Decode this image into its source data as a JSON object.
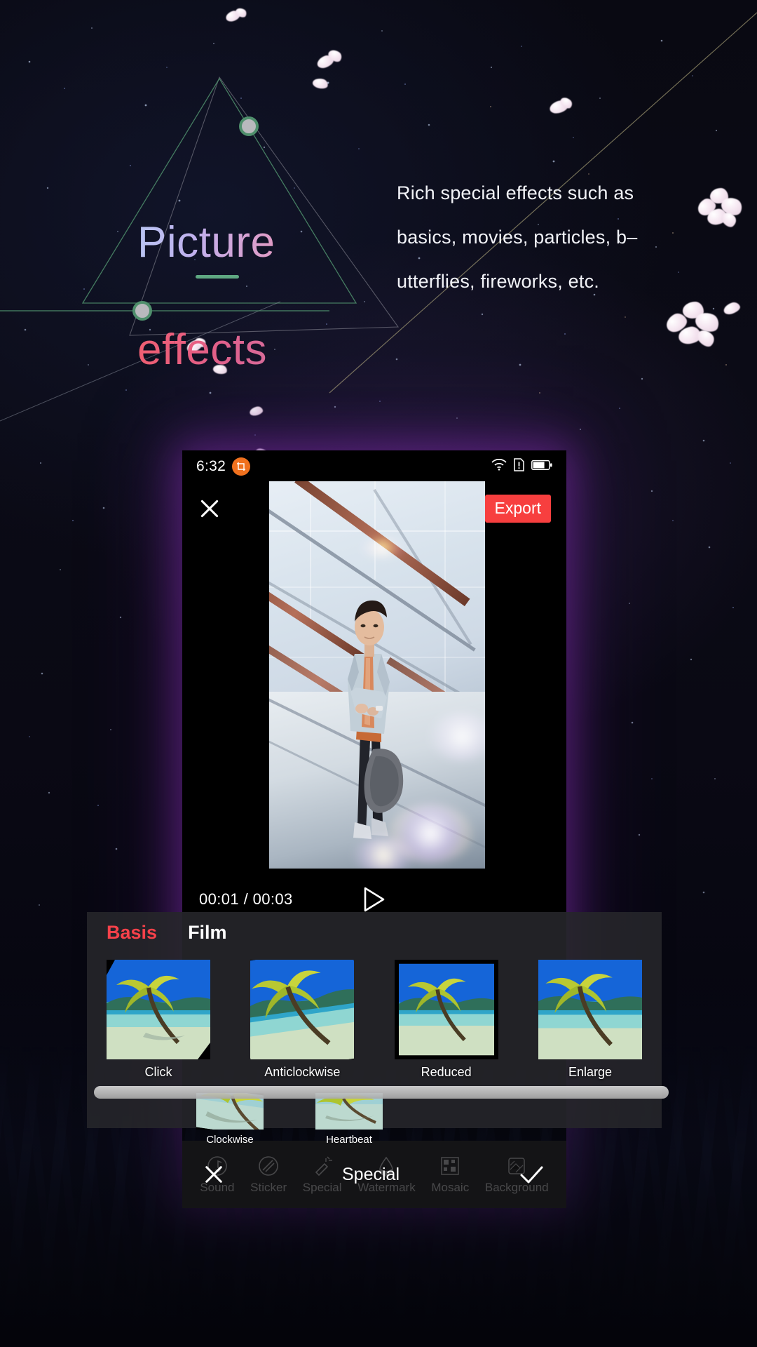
{
  "hero": {
    "title_line1": "Picture",
    "title_line2": "effects",
    "description": "Rich special effects such as basics, movies, particles, b–utterflies, fireworks, etc.",
    "accent_green": "#5fa882",
    "title_gradient_top": "#b9c4f2",
    "title_gradient_bottom": "#ef5f72"
  },
  "phone": {
    "statusbar": {
      "time": "6:32",
      "badge_icon": "crop-icon",
      "wifi_icon": "wifi-icon",
      "sim_icon": "sim-alert-icon",
      "battery_icon": "battery-icon"
    },
    "topbar": {
      "close_icon": "close-icon",
      "export_label": "Export",
      "export_color": "#f73f3f"
    },
    "preview": {
      "alt": "young man in denim jacket standing on stairs inside glass building"
    },
    "timeline": {
      "current_time": "00:01",
      "separator": "/",
      "total_time": "00:03",
      "time_display": "00:01 / 00:03",
      "play_icon": "play-icon"
    },
    "effects_panel": {
      "tabs": [
        {
          "label": "Basis",
          "active": true
        },
        {
          "label": "Film",
          "active": false
        }
      ],
      "active_tab_color": "#f7414a",
      "items_row1": [
        {
          "label": "Click"
        },
        {
          "label": "Anticlockwise"
        },
        {
          "label": "Reduced"
        },
        {
          "label": "Enlarge"
        }
      ],
      "items_row2": [
        {
          "label": "Clockwise"
        },
        {
          "label": "Heartbeat"
        }
      ]
    },
    "toolbar": {
      "ghost_items": [
        {
          "label": "Sound",
          "icon": "music-note-icon"
        },
        {
          "label": "Sticker",
          "icon": "sticker-icon"
        },
        {
          "label": "Special",
          "icon": "magic-wand-icon"
        },
        {
          "label": "Watermark",
          "icon": "water-drop-icon"
        },
        {
          "label": "Mosaic",
          "icon": "mosaic-icon"
        },
        {
          "label": "Background",
          "icon": "background-icon"
        }
      ],
      "overlay": {
        "cancel_icon": "close-icon",
        "title": "Special",
        "confirm_icon": "check-icon"
      }
    }
  }
}
